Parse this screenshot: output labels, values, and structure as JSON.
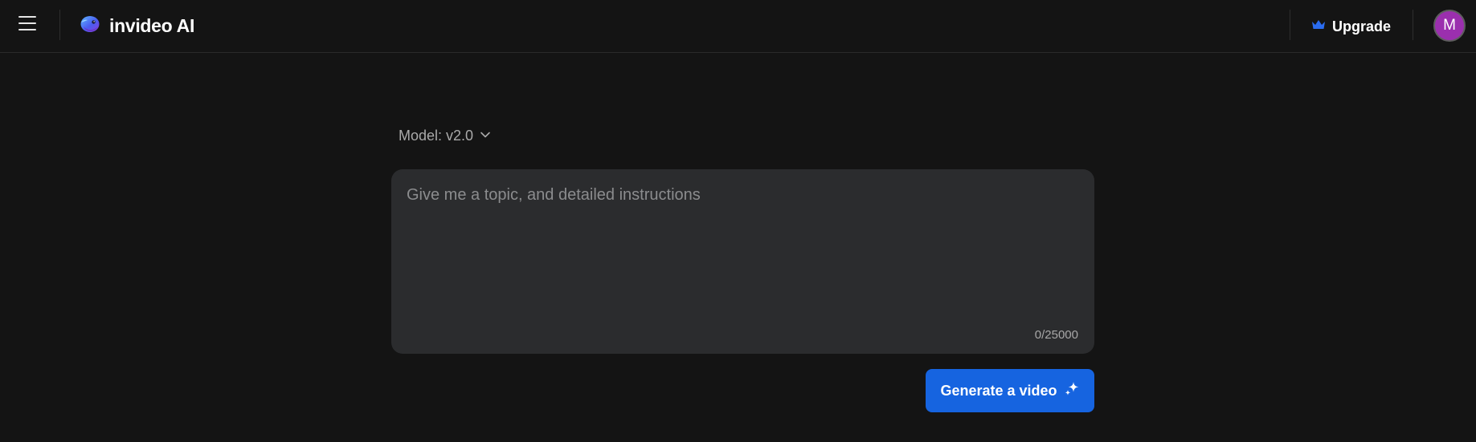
{
  "header": {
    "brand_name": "invideo AI",
    "upgrade_label": "Upgrade",
    "avatar_initial": "M",
    "icons": {
      "menu": "hamburger-menu-icon",
      "logo": "invideo-logo-icon",
      "upgrade": "crown-icon"
    }
  },
  "main": {
    "model_selector": {
      "label": "Model: v2.0",
      "icon": "chevron-down-icon"
    },
    "prompt": {
      "placeholder": "Give me a topic, and detailed instructions",
      "value": "",
      "char_count": "0/25000"
    },
    "generate_button": {
      "label": "Generate a video",
      "icon": "sparkle-icon"
    }
  },
  "colors": {
    "background": "#141414",
    "input_background": "#2b2c2e",
    "accent": "#1664e0",
    "avatar": "#9b2fae",
    "crown": "#2b6cf0"
  }
}
